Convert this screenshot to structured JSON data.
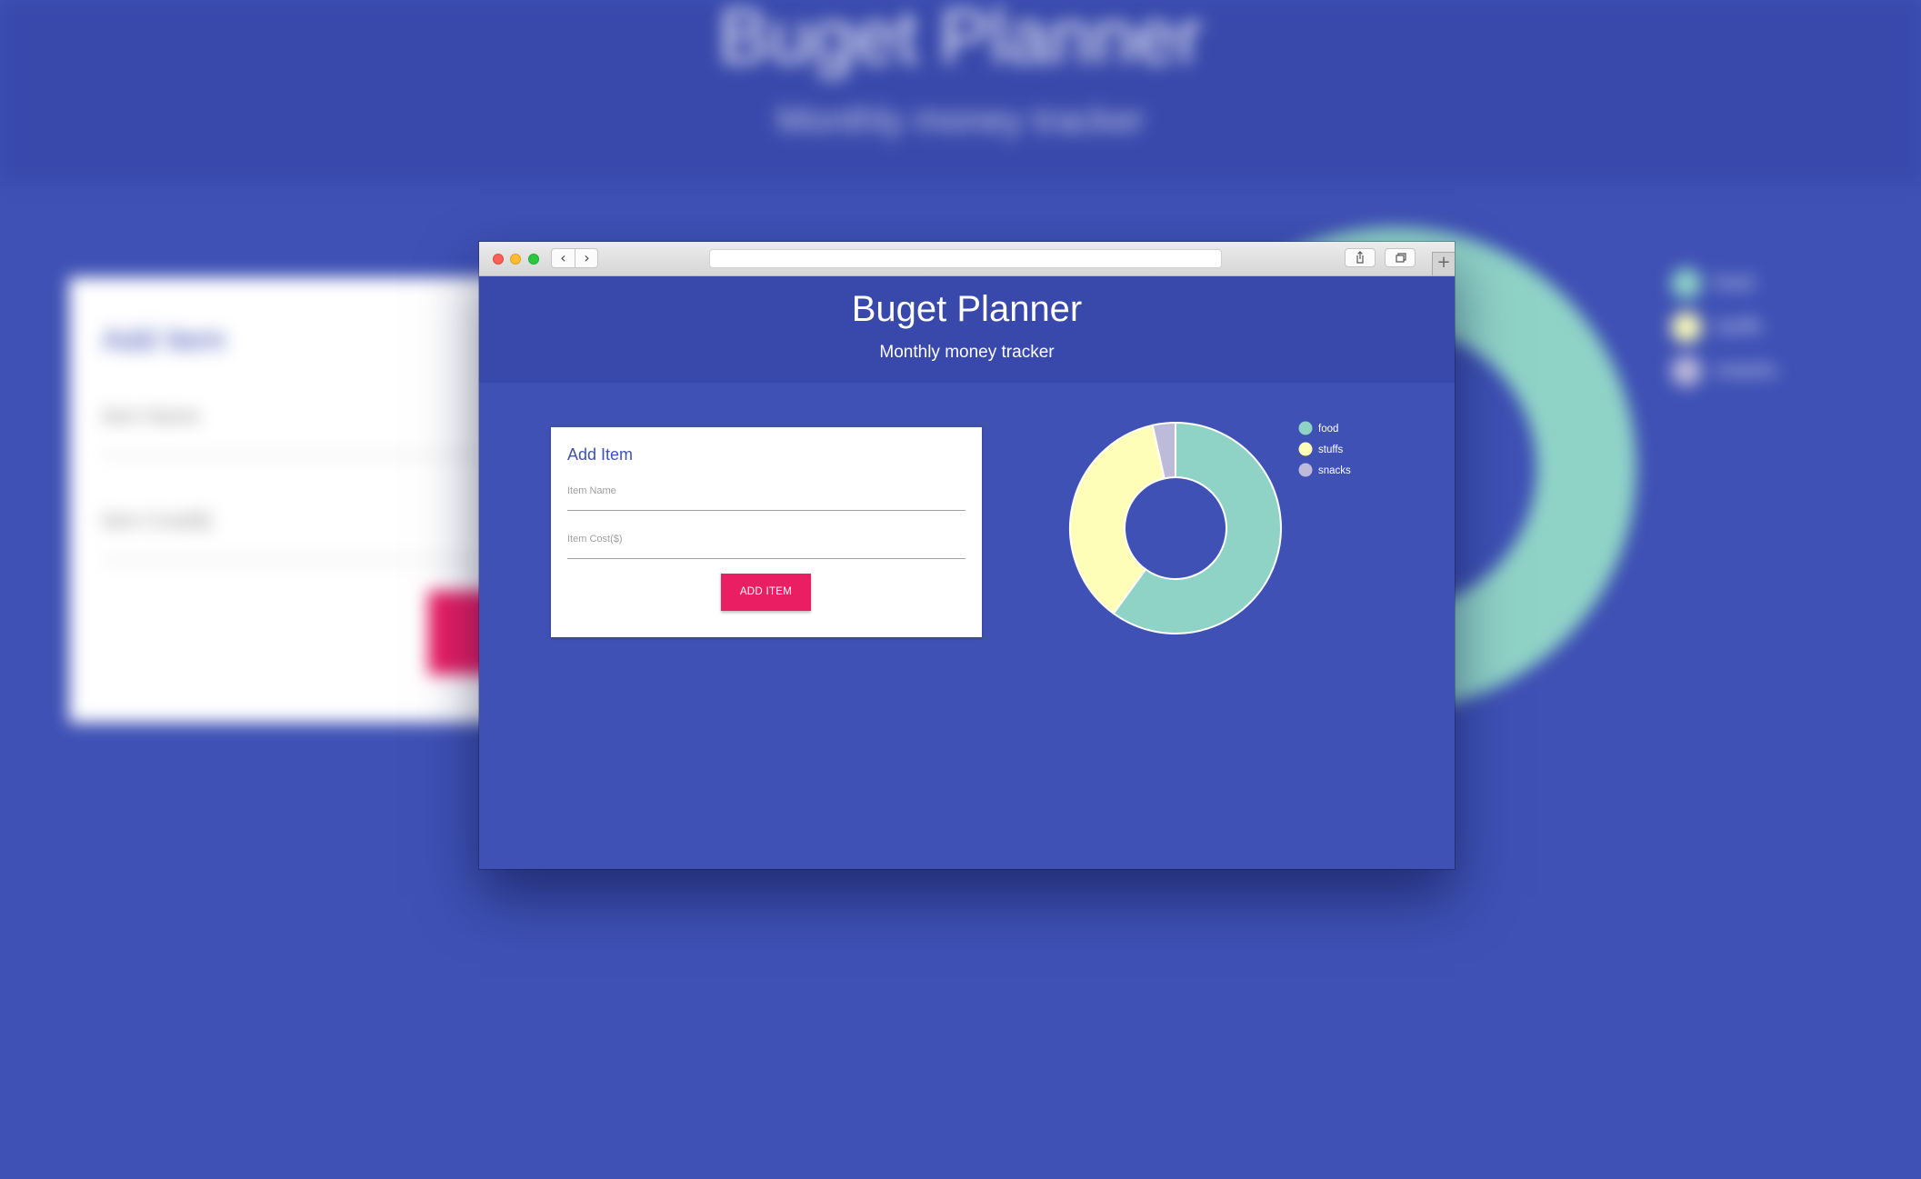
{
  "app": {
    "title": "Buget Planner",
    "subtitle": "Monthly money tracker"
  },
  "form": {
    "title": "Add Item",
    "item_name_placeholder": "Item Name",
    "item_cost_placeholder": "Item Cost($)",
    "button_label": "ADD ITEM"
  },
  "browser": {
    "back_icon": "chevron-left-icon",
    "forward_icon": "chevron-right-icon",
    "share_icon": "share-icon",
    "tabs_icon": "tabs-icon",
    "new_tab_icon": "plus-icon"
  },
  "colors": {
    "page_bg": "#3f51b5",
    "header_bg": "#3949ab",
    "accent": "#e91e63",
    "food": "#8fd3c7",
    "stuffs": "#fefeb8",
    "snacks": "#bebada"
  },
  "chart_data": {
    "type": "pie",
    "style": "donut",
    "categories": [
      "food",
      "stuffs",
      "snacks"
    ],
    "values": [
      60,
      36.5,
      3.5
    ],
    "colors": [
      "#8fd3c7",
      "#fefeb8",
      "#bebada"
    ],
    "legend": "right",
    "title": ""
  }
}
